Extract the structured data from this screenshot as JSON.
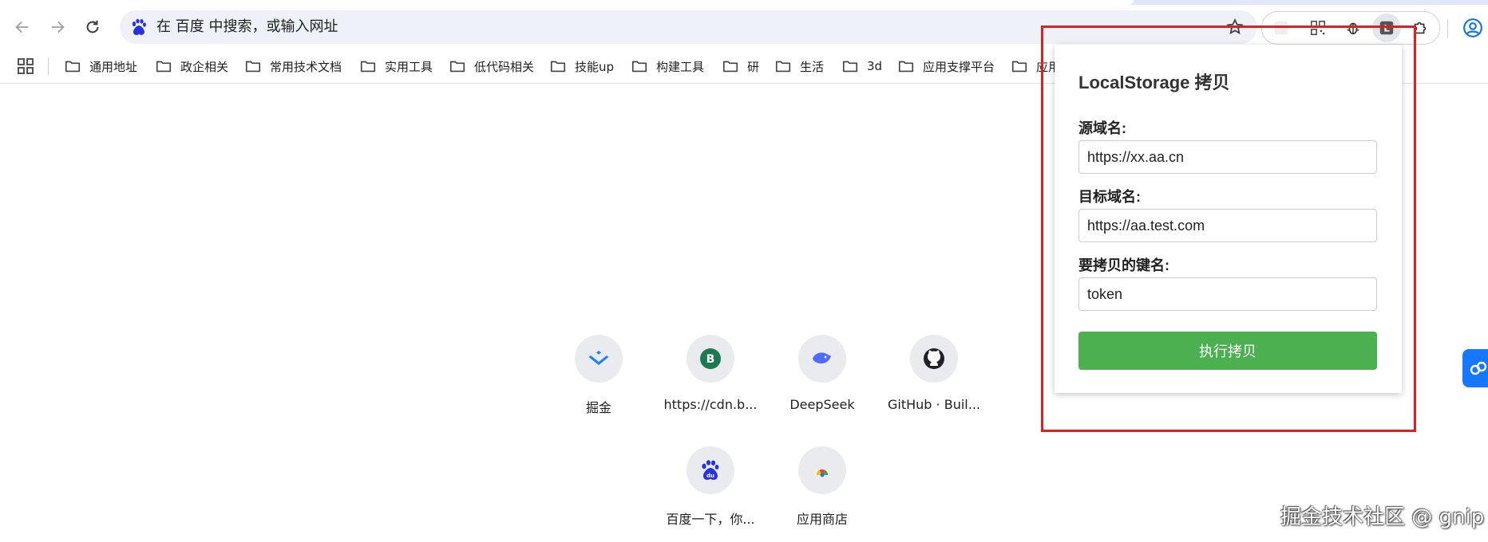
{
  "omnibox": {
    "placeholder_text": "在 百度 中搜索，或输入网址"
  },
  "bookmarks": [
    "通用地址",
    "政企相关",
    "常用技术文档",
    "实用工具",
    "低代码相关",
    "技能up",
    "构建工具",
    "研",
    "生活",
    "3d",
    "应用支撑平台",
    "应用"
  ],
  "shortcuts": [
    {
      "label": "掘金",
      "icon": "juejin-icon"
    },
    {
      "label": "https://cdn.b...",
      "icon": "letter-b-icon",
      "letter": "B"
    },
    {
      "label": "DeepSeek",
      "icon": "deepseek-whale-icon"
    },
    {
      "label": "GitHub · Buil...",
      "icon": "github-icon"
    },
    {
      "label": "百度一下，你...",
      "icon": "baidu-icon",
      "text": "du"
    },
    {
      "label": "应用商店",
      "icon": "chrome-web-store-icon"
    }
  ],
  "popup": {
    "title": "LocalStorage 拷贝",
    "source_label": "源域名:",
    "source_value": "https://xx.aa.cn",
    "target_label": "目标域名:",
    "target_value": "https://aa.test.com",
    "key_label": "要拷贝的键名:",
    "key_value": "token",
    "button_label": "执行拷贝"
  },
  "extensions": {
    "active_letter": "L"
  },
  "colors": {
    "button_green": "#4caf50",
    "highlight_red": "#e02020",
    "side_button_blue": "#1677ff"
  },
  "watermark": "掘金技术社区 @ gnip"
}
